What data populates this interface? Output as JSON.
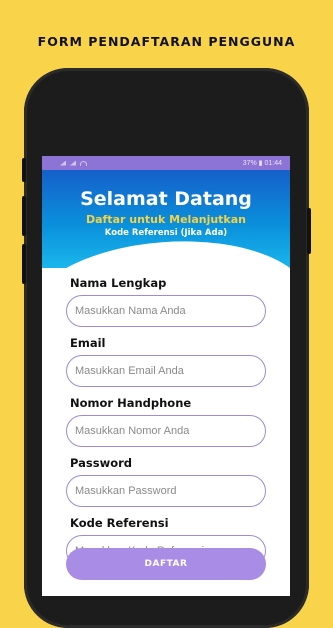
{
  "promo": {
    "title": "FORM PENDAFTARAN PENGGUNA"
  },
  "status_bar": {
    "battery": "37%",
    "time": "01:44"
  },
  "header": {
    "title": "Selamat Datang",
    "subtitle": "Daftar untuk Melanjutkan",
    "note": "Kode Referensi (Jika Ada)"
  },
  "form": {
    "fields": [
      {
        "label": "Nama Lengkap",
        "placeholder": "Masukkan Nama Anda"
      },
      {
        "label": "Email",
        "placeholder": "Masukkan Email Anda"
      },
      {
        "label": "Nomor Handphone",
        "placeholder": "Masukkan Nomor Anda"
      },
      {
        "label": "Password",
        "placeholder": "Masukkan Password"
      },
      {
        "label": "Kode Referensi",
        "placeholder": "Masukkan Kode Referensi"
      }
    ],
    "submit_label": "DAFTAR"
  },
  "colors": {
    "background": "#F9D44A",
    "status_bar": "#8C73D6",
    "header_gradient_top": "#1560c9",
    "header_gradient_bottom": "#19b6ec",
    "subtitle": "#F7D245",
    "button": "#A98CE6",
    "input_border": "#9C8BE0"
  }
}
